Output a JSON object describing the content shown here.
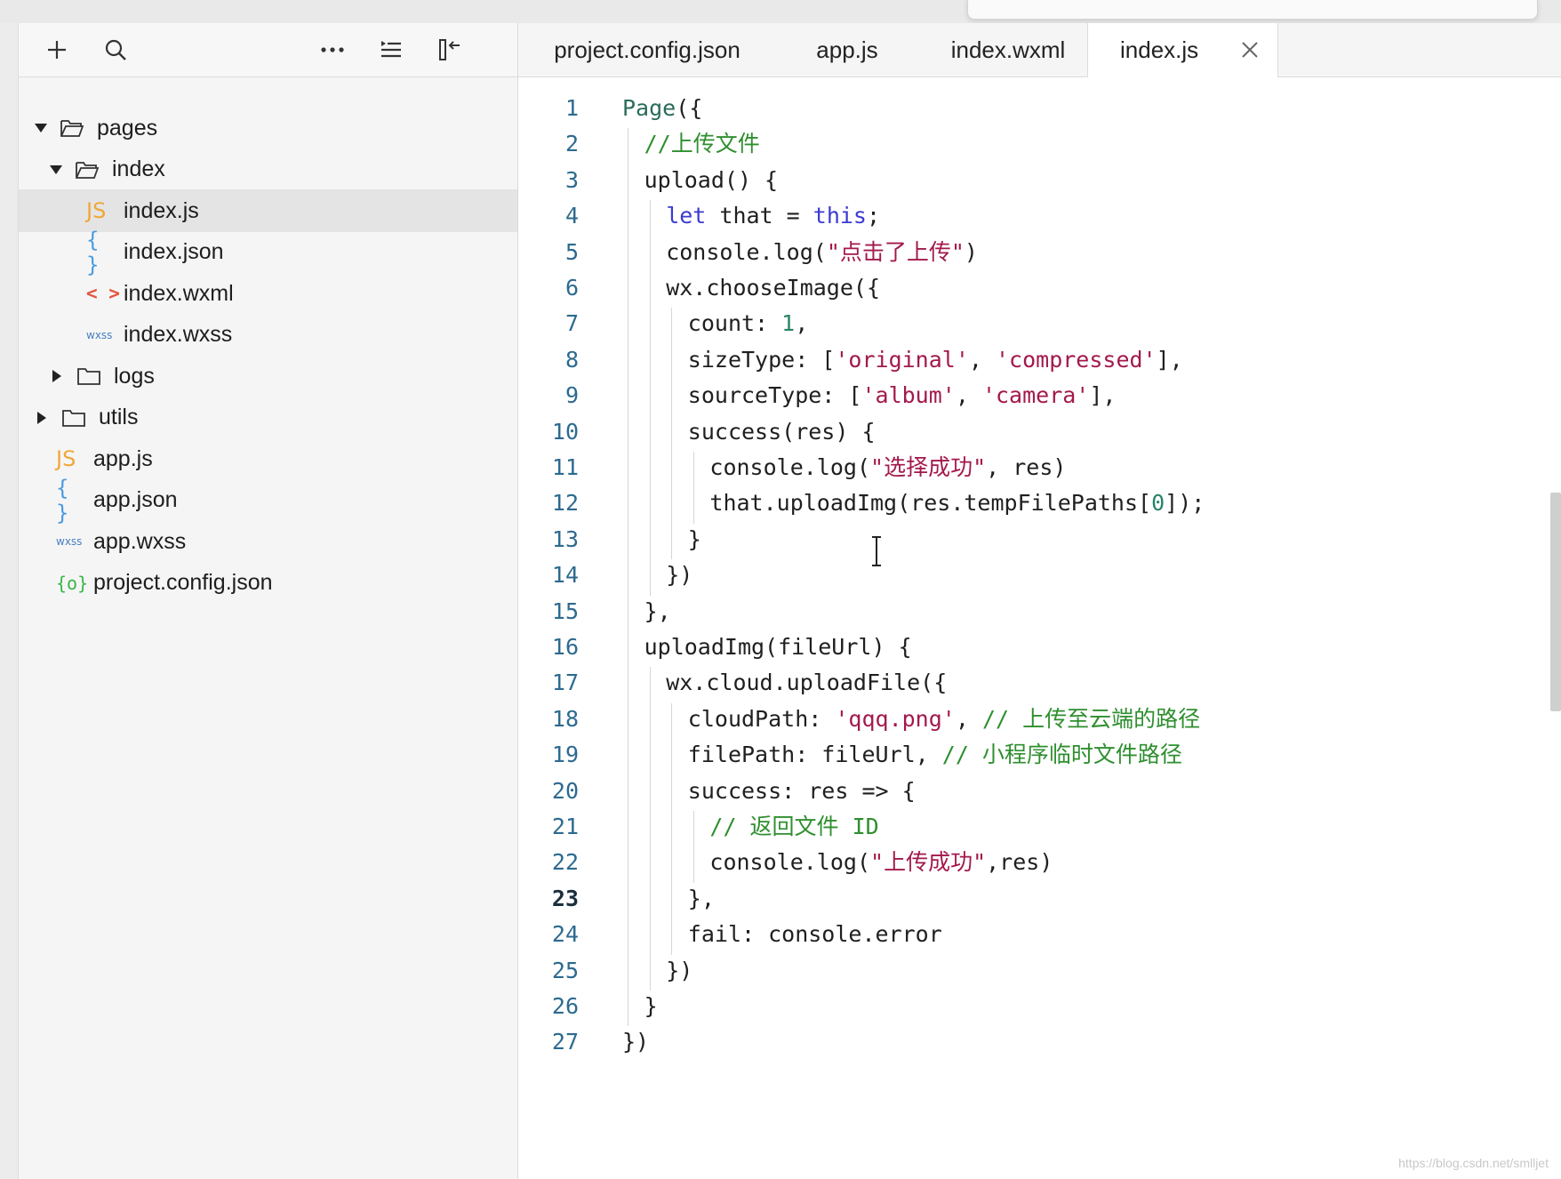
{
  "sidebar": {
    "toolbar": {
      "add_icon": "plus-icon",
      "search_icon": "search-icon",
      "more_icon": "more-icon",
      "outline_icon": "outline-icon",
      "collapse_icon": "collapse-panel-icon"
    },
    "tree": [
      {
        "label": "pages",
        "type": "folder-open",
        "indent": 0,
        "expanded": true
      },
      {
        "label": "index",
        "type": "folder-open",
        "indent": 1,
        "expanded": true
      },
      {
        "label": "index.js",
        "type": "js",
        "indent": 2,
        "selected": true
      },
      {
        "label": "index.json",
        "type": "json",
        "indent": 2
      },
      {
        "label": "index.wxml",
        "type": "wxml",
        "indent": 2
      },
      {
        "label": "index.wxss",
        "type": "wxss",
        "indent": 2
      },
      {
        "label": "logs",
        "type": "folder",
        "indent": 1,
        "expanded": false
      },
      {
        "label": "utils",
        "type": "folder",
        "indent": 0,
        "expanded": false
      },
      {
        "label": "app.js",
        "type": "js",
        "indent": 0
      },
      {
        "label": "app.json",
        "type": "json",
        "indent": 0
      },
      {
        "label": "app.wxss",
        "type": "wxss",
        "indent": 0
      },
      {
        "label": "project.config.json",
        "type": "config",
        "indent": 0
      }
    ],
    "icon_glyphs": {
      "js": "JS",
      "json": "{ }",
      "wxml": "< >",
      "wxss": "wxss",
      "config": "{o}"
    }
  },
  "editor": {
    "tabs": [
      {
        "label": "project.config.json"
      },
      {
        "label": "app.js"
      },
      {
        "label": "index.wxml"
      },
      {
        "label": "index.js",
        "active": true
      }
    ],
    "current_line": 23,
    "lines": [
      {
        "n": "1",
        "indent": 0,
        "tokens": [
          [
            "fn",
            "Page"
          ],
          [
            "",
            "({"
          ]
        ]
      },
      {
        "n": "2",
        "indent": 1,
        "tokens": [
          [
            "cmt",
            "//上传文件"
          ]
        ]
      },
      {
        "n": "3",
        "indent": 1,
        "tokens": [
          [
            "",
            "upload() {"
          ]
        ]
      },
      {
        "n": "4",
        "indent": 2,
        "tokens": [
          [
            "kw",
            "let"
          ],
          [
            "",
            " that = "
          ],
          [
            "kw",
            "this"
          ],
          [
            "",
            ";"
          ]
        ]
      },
      {
        "n": "5",
        "indent": 2,
        "tokens": [
          [
            "",
            "console.log("
          ],
          [
            "str",
            "\"点击了上传\""
          ],
          [
            "",
            ")"
          ]
        ]
      },
      {
        "n": "6",
        "indent": 2,
        "tokens": [
          [
            "",
            "wx.chooseImage({"
          ]
        ]
      },
      {
        "n": "7",
        "indent": 3,
        "tokens": [
          [
            "",
            "count: "
          ],
          [
            "num",
            "1"
          ],
          [
            "",
            ","
          ]
        ]
      },
      {
        "n": "8",
        "indent": 3,
        "tokens": [
          [
            "",
            "sizeType: ["
          ],
          [
            "str",
            "'original'"
          ],
          [
            "",
            ", "
          ],
          [
            "str",
            "'compressed'"
          ],
          [
            "",
            "],"
          ]
        ]
      },
      {
        "n": "9",
        "indent": 3,
        "tokens": [
          [
            "",
            "sourceType: ["
          ],
          [
            "str",
            "'album'"
          ],
          [
            "",
            ", "
          ],
          [
            "str",
            "'camera'"
          ],
          [
            "",
            "],"
          ]
        ]
      },
      {
        "n": "10",
        "indent": 3,
        "tokens": [
          [
            "",
            "success(res) {"
          ]
        ]
      },
      {
        "n": "11",
        "indent": 4,
        "tokens": [
          [
            "",
            "console.log("
          ],
          [
            "str",
            "\"选择成功\""
          ],
          [
            "",
            ", res)"
          ]
        ]
      },
      {
        "n": "12",
        "indent": 4,
        "tokens": [
          [
            "",
            "that.uploadImg(res.tempFilePaths["
          ],
          [
            "num",
            "0"
          ],
          [
            "",
            "]);"
          ]
        ]
      },
      {
        "n": "13",
        "indent": 3,
        "tokens": [
          [
            "",
            "}"
          ]
        ]
      },
      {
        "n": "14",
        "indent": 2,
        "tokens": [
          [
            "",
            "})"
          ]
        ]
      },
      {
        "n": "15",
        "indent": 1,
        "tokens": [
          [
            "",
            "},"
          ]
        ]
      },
      {
        "n": "16",
        "indent": 1,
        "tokens": [
          [
            "",
            "uploadImg(fileUrl) {"
          ]
        ]
      },
      {
        "n": "17",
        "indent": 2,
        "tokens": [
          [
            "",
            "wx.cloud.uploadFile({"
          ]
        ]
      },
      {
        "n": "18",
        "indent": 3,
        "tokens": [
          [
            "",
            "cloudPath: "
          ],
          [
            "str",
            "'qqq.png'"
          ],
          [
            "",
            ", "
          ],
          [
            "cmt",
            "// 上传至云端的路径"
          ]
        ]
      },
      {
        "n": "19",
        "indent": 3,
        "tokens": [
          [
            "",
            "filePath: fileUrl, "
          ],
          [
            "cmt",
            "// 小程序临时文件路径"
          ]
        ]
      },
      {
        "n": "20",
        "indent": 3,
        "tokens": [
          [
            "",
            "success: res => {"
          ]
        ]
      },
      {
        "n": "21",
        "indent": 4,
        "tokens": [
          [
            "cmt",
            "// 返回文件 ID"
          ]
        ]
      },
      {
        "n": "22",
        "indent": 4,
        "tokens": [
          [
            "",
            "console.log("
          ],
          [
            "str",
            "\"上传成功\""
          ],
          [
            "",
            ",res)"
          ]
        ]
      },
      {
        "n": "23",
        "indent": 3,
        "tokens": [
          [
            "",
            "},"
          ]
        ]
      },
      {
        "n": "24",
        "indent": 3,
        "tokens": [
          [
            "",
            "fail: console.error"
          ]
        ]
      },
      {
        "n": "25",
        "indent": 2,
        "tokens": [
          [
            "",
            "})"
          ]
        ]
      },
      {
        "n": "26",
        "indent": 1,
        "tokens": [
          [
            "",
            "}"
          ]
        ]
      },
      {
        "n": "27",
        "indent": 0,
        "tokens": [
          [
            "",
            "})"
          ]
        ]
      }
    ]
  },
  "watermark": "https://blog.csdn.net/smlljet",
  "colors": {
    "keyword": "#3b3bd1",
    "string": "#a3194c",
    "comment": "#2f8f2f",
    "number": "#29836a",
    "line_number": "#2d6a8f"
  }
}
